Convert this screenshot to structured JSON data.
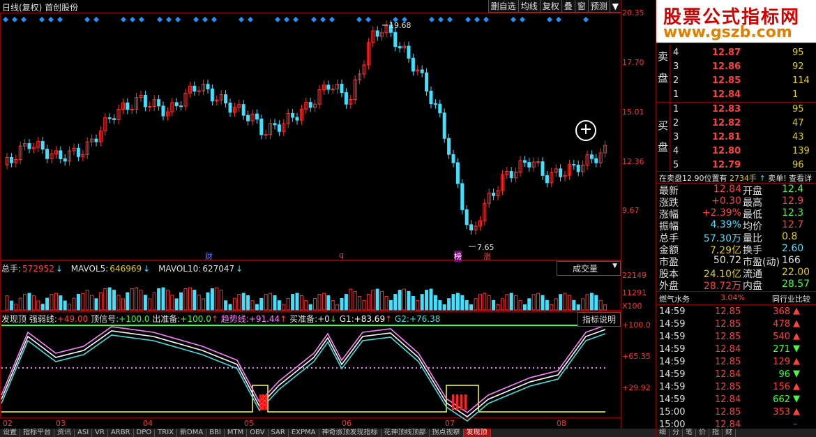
{
  "header": {
    "title": "日线(复权) 首创股份",
    "tools": [
      "删自选",
      "均线",
      "复权",
      "叠",
      "窗",
      "预测"
    ],
    "arrow": "▼"
  },
  "price_axis": [
    "20.35",
    "17.70",
    "15.01",
    "12.36",
    "9.67"
  ],
  "annotations": {
    "high": "19.68",
    "low": "7.65",
    "markers": [
      "财",
      "q",
      "榜",
      "涨"
    ]
  },
  "volume": {
    "total_label": "总手:",
    "total_value": "572952",
    "mavol5_label": "MAVOL5:",
    "mavol5_value": "646969",
    "mavol10_label": "MAVOL10:",
    "mavol10_value": "627047",
    "dropdown": "成交量",
    "axis": [
      "22149",
      "11291",
      "X100"
    ]
  },
  "indicator": {
    "parts": [
      {
        "text": "发现顶 强弱线:",
        "color": "#e0e0e0"
      },
      {
        "text": "+49.00",
        "color": "#ff4040"
      },
      {
        "text": " 顶信号:",
        "color": "#e0e0e0"
      },
      {
        "text": "+100.0",
        "color": "#40ff40"
      },
      {
        "text": " 出准备:",
        "color": "#e0e0e0"
      },
      {
        "text": "+100.0",
        "color": "#40ff40"
      },
      {
        "text": "↑",
        "color": "#ff4040"
      },
      {
        "text": "  趋势线:",
        "color": "#ff80ff"
      },
      {
        "text": "+91.44",
        "color": "#ff80ff"
      },
      {
        "text": "↑",
        "color": "#ff4040"
      },
      {
        "text": "  买准备:",
        "color": "#e0e0e0"
      },
      {
        "text": "+0",
        "color": "#e0e0e0"
      },
      {
        "text": "↓",
        "color": "#40ff40"
      },
      {
        "text": "  G1:",
        "color": "#e0e0e0"
      },
      {
        "text": "+83.69",
        "color": "#ffffff"
      },
      {
        "text": "↑",
        "color": "#ff4040"
      },
      {
        "text": "  G2:",
        "color": "#40e0e0"
      },
      {
        "text": "+76.38",
        "color": "#40e0e0"
      }
    ],
    "explain_button": "指标说明",
    "axis": [
      "+100.0",
      "+65.35",
      "+29.92"
    ]
  },
  "dates": [
    "02",
    "03",
    "04",
    "05",
    "06",
    "07",
    "08"
  ],
  "tabs": [
    "设置",
    "指标平台",
    "资讯",
    "ASI",
    "VR",
    "ARBR",
    "DPO",
    "TRIX",
    "新DMA",
    "BBI",
    "MTM",
    "OBV",
    "SAR",
    "EXPMA",
    "神奇涨顶发现指标",
    "花神顶线顶部",
    "拐点视察",
    "发现顶"
  ],
  "active_tab": "发现顶",
  "banner": {
    "line1": "股票公式指标网",
    "line2": "www.gszb.com"
  },
  "orderbook": {
    "sell_label": [
      "卖",
      "盘"
    ],
    "buy_label": [
      "买",
      "盘"
    ],
    "sell": [
      {
        "level": "4",
        "price": "12.87",
        "vol": "95"
      },
      {
        "level": "3",
        "price": "12.86",
        "vol": "92"
      },
      {
        "level": "2",
        "price": "12.85",
        "vol": "114"
      },
      {
        "level": "1",
        "price": "12.84",
        "vol": "1"
      }
    ],
    "buy": [
      {
        "level": "1",
        "price": "12.83",
        "vol": "95"
      },
      {
        "level": "2",
        "price": "12.82",
        "vol": "47"
      },
      {
        "level": "3",
        "price": "12.81",
        "vol": "43"
      },
      {
        "level": "4",
        "price": "12.80",
        "vol": "139"
      },
      {
        "level": "5",
        "price": "12.79",
        "vol": "96"
      }
    ]
  },
  "info_line": {
    "a": "在卖盘12.90位置有",
    "b": "2734手",
    "c": "卖单!",
    "d": "查看详"
  },
  "quote": [
    {
      "l1": "最新",
      "v1": "12.84",
      "c1": "#ff4040",
      "l2": "开盘",
      "v2": "12.4",
      "c2": "#40ff40"
    },
    {
      "l1": "涨跌",
      "v1": "+0.30",
      "c1": "#ff4040",
      "l2": "最高",
      "v2": "12.9",
      "c2": "#ff4040"
    },
    {
      "l1": "涨幅",
      "v1": "+2.39%",
      "c1": "#ff4040",
      "l2": "最低",
      "v2": "12.3",
      "c2": "#40ff40"
    },
    {
      "l1": "振幅",
      "v1": "4.39%",
      "c1": "#40e0ff",
      "l2": "均价",
      "v2": "12.7",
      "c2": "#ff4040"
    },
    {
      "l1": "总手",
      "v1": "57.30万",
      "c1": "#40e0ff",
      "l2": "量比",
      "v2": "0.8",
      "c2": "#e0d000"
    },
    {
      "l1": "金额",
      "v1": "7.29亿",
      "c1": "#e0d000",
      "l2": "换手",
      "v2": "2.60",
      "c2": "#40e0ff"
    },
    {
      "l1": "市盈",
      "v1": "50.72",
      "c1": "#e0e0e0",
      "l2": "市盈(动)",
      "v2": "166",
      "c2": "#e0e0e0"
    },
    {
      "l1": "股本",
      "v1": "24.10亿",
      "c1": "#e0d000",
      "l2": "流通",
      "v2": "22.00",
      "c2": "#e0d000"
    },
    {
      "l1": "外盘",
      "v1": "28.72万",
      "c1": "#ff4040",
      "l2": "内盘",
      "v2": "28.57",
      "c2": "#40ff40"
    }
  ],
  "sector": {
    "name": "燃气水务",
    "pct": "3.04%",
    "compare": "同行业比较"
  },
  "ticks": [
    {
      "t": "14:59",
      "p": "12.85",
      "v": "368",
      "d": "up"
    },
    {
      "t": "14:59",
      "p": "12.85",
      "v": "478",
      "d": "up"
    },
    {
      "t": "14:59",
      "p": "12.85",
      "v": "540",
      "d": "up"
    },
    {
      "t": "14:59",
      "p": "12.84",
      "v": "271",
      "d": "down"
    },
    {
      "t": "14:59",
      "p": "12.85",
      "v": "129",
      "d": "up"
    },
    {
      "t": "14:59",
      "p": "12.84",
      "v": "96",
      "d": "down"
    },
    {
      "t": "14:59",
      "p": "12.85",
      "v": "156",
      "d": "up"
    },
    {
      "t": "14:59",
      "p": "12.84",
      "v": "662",
      "d": "down"
    },
    {
      "t": "15:00",
      "p": "12.85",
      "v": "353",
      "d": "up"
    },
    {
      "t": "15:00",
      "p": "12.84",
      "v": "",
      "d": "none"
    }
  ],
  "bottom_tabs": [
    "细",
    "分",
    "笔",
    "价",
    "指",
    "财"
  ]
}
